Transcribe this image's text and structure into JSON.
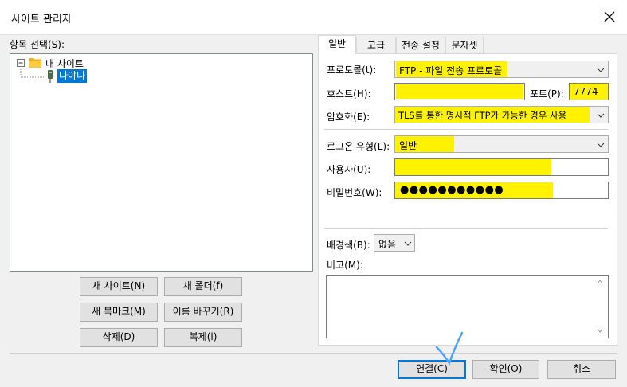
{
  "window": {
    "title": "사이트 관리자"
  },
  "tree": {
    "heading": "항목 선택(S):",
    "root_label": "내 사이트",
    "child_label": "나야나"
  },
  "left_buttons": {
    "new_site": "새 사이트(N)",
    "new_folder": "새 폴더(f)",
    "new_bookmark": "새 북마크(M)",
    "rename": "이름 바꾸기(R)",
    "delete": "삭제(D)",
    "duplicate": "복제(i)"
  },
  "tabs": [
    "일반",
    "고급",
    "전송 설정",
    "문자셋"
  ],
  "general": {
    "protocol_label": "프로토콜(t):",
    "protocol_value": "FTP - 파일 전송 프로토콜",
    "host_label": "호스트(H):",
    "host_value": "",
    "port_label": "포트(P):",
    "port_value": "7774",
    "encryption_label": "암호화(E):",
    "encryption_value": "TLS를 통한 명시적 FTP가 가능한 경우 사용",
    "logon_label": "로그온 유형(L):",
    "logon_value": "일반",
    "user_label": "사용자(U):",
    "user_value": "",
    "password_label": "비밀번호(W):",
    "password_value": "●●●●●●●●●●●",
    "bgcolor_label": "배경색(B):",
    "bgcolor_value": "없음",
    "comments_label": "비고(M):",
    "comments_value": ""
  },
  "dialog_buttons": {
    "connect": "연결(C)",
    "ok": "확인(O)",
    "cancel": "취소"
  },
  "colors": {
    "highlight": "#fff200",
    "selection": "#0078d7",
    "annotation_check": "#4aa3ff"
  }
}
